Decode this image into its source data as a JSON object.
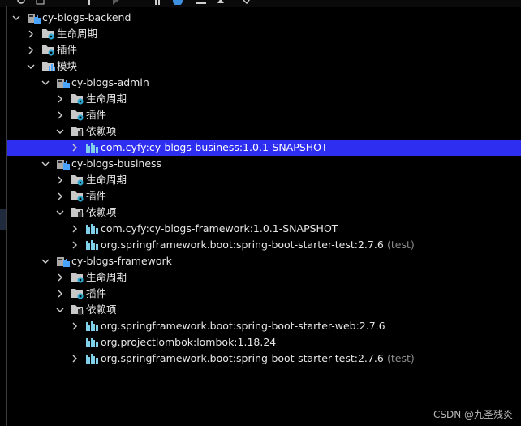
{
  "toolbar": {
    "icons": [
      "refresh-icon",
      "reimport-icon",
      "add-icon",
      "run-icon",
      "toggle-icon",
      "info-icon",
      "expand-icon",
      "collapse-icon",
      "settings-icon"
    ]
  },
  "colors": {
    "background": "#000000",
    "selection": "#2e2ef0",
    "module_icon_blue": "#4aa3ff",
    "dependency_icon": "#7fd0e8",
    "scope_text": "#8c8c8c"
  },
  "tree": [
    {
      "level": 0,
      "arrow": "down",
      "icon": "maven-module-icon",
      "label": "cy-blogs-backend"
    },
    {
      "level": 1,
      "arrow": "right",
      "icon": "lifecycle-folder-icon",
      "label": "生命周期"
    },
    {
      "level": 1,
      "arrow": "right",
      "icon": "plugins-folder-icon",
      "label": "插件"
    },
    {
      "level": 1,
      "arrow": "down",
      "icon": "modules-folder-icon",
      "label": "模块"
    },
    {
      "level": 2,
      "arrow": "down",
      "icon": "maven-module-icon",
      "label": "cy-blogs-admin"
    },
    {
      "level": 3,
      "arrow": "right",
      "icon": "lifecycle-folder-icon",
      "label": "生命周期"
    },
    {
      "level": 3,
      "arrow": "right",
      "icon": "plugins-folder-icon",
      "label": "插件"
    },
    {
      "level": 3,
      "arrow": "down",
      "icon": "dependencies-folder-icon",
      "label": "依赖项"
    },
    {
      "level": 4,
      "arrow": "right",
      "icon": "dependency-icon",
      "label": "com.cyfy:cy-blogs-business:1.0.1-SNAPSHOT",
      "selected": true
    },
    {
      "level": 2,
      "arrow": "down",
      "icon": "maven-module-icon",
      "label": "cy-blogs-business"
    },
    {
      "level": 3,
      "arrow": "right",
      "icon": "lifecycle-folder-icon",
      "label": "生命周期"
    },
    {
      "level": 3,
      "arrow": "right",
      "icon": "plugins-folder-icon",
      "label": "插件"
    },
    {
      "level": 3,
      "arrow": "down",
      "icon": "dependencies-folder-icon",
      "label": "依赖项"
    },
    {
      "level": 4,
      "arrow": "right",
      "icon": "dependency-icon",
      "label": "com.cyfy:cy-blogs-framework:1.0.1-SNAPSHOT"
    },
    {
      "level": 4,
      "arrow": "right",
      "icon": "dependency-icon",
      "label": "org.springframework.boot:spring-boot-starter-test:2.7.6",
      "scope": "(test)"
    },
    {
      "level": 2,
      "arrow": "down",
      "icon": "maven-module-icon",
      "label": "cy-blogs-framework"
    },
    {
      "level": 3,
      "arrow": "right",
      "icon": "lifecycle-folder-icon",
      "label": "生命周期"
    },
    {
      "level": 3,
      "arrow": "right",
      "icon": "plugins-folder-icon",
      "label": "插件"
    },
    {
      "level": 3,
      "arrow": "down",
      "icon": "dependencies-folder-icon",
      "label": "依赖项"
    },
    {
      "level": 4,
      "arrow": "right",
      "icon": "dependency-icon",
      "label": "org.springframework.boot:spring-boot-starter-web:2.7.6"
    },
    {
      "level": 4,
      "arrow": "none",
      "icon": "dependency-icon",
      "label": "org.projectlombok:lombok:1.18.24"
    },
    {
      "level": 4,
      "arrow": "right",
      "icon": "dependency-icon",
      "label": "org.springframework.boot:spring-boot-starter-test:2.7.6",
      "scope": "(test)"
    }
  ],
  "watermark": "CSDN @九圣残炎"
}
